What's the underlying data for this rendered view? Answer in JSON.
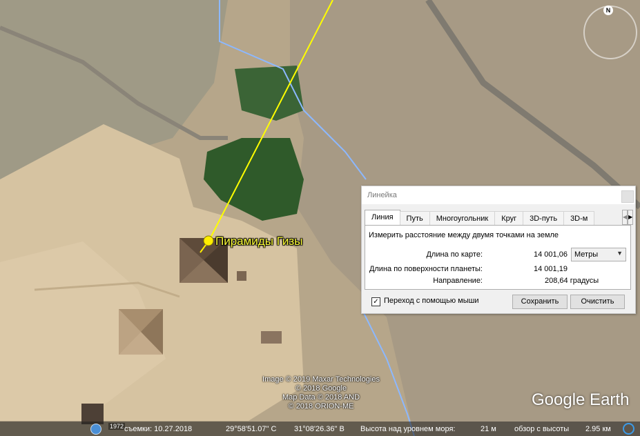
{
  "map": {
    "placemark_label": "Пирамиды Гизы",
    "attribution_lines": [
      "Image © 2019 Maxar Technologies",
      "© 2018 Google",
      "Map Data © 2018 AND",
      "© 2018 ORION-ME"
    ],
    "logo": "Google Earth",
    "compass_letter": "N",
    "colors": {
      "ruler_line": "#ffff00",
      "road_outline": "#8cb8ff",
      "placemark": "#ffee00"
    }
  },
  "ruler": {
    "title": "Линейка",
    "tabs": [
      "Линия",
      "Путь",
      "Многоугольник",
      "Круг",
      "3D-путь",
      "3D-м"
    ],
    "active_tab": "Линия",
    "description": "Измерить расстояние между двумя точками на земле",
    "map_length_label": "Длина по карте:",
    "map_length_value": "14 001,06",
    "units": "Метры",
    "ground_length_label": "Длина по поверхности планеты:",
    "ground_length_value": "14 001,19",
    "heading_label": "Направление:",
    "heading_value": "208,64 градусы",
    "mouse_nav_label": "Переход с помощью мыши",
    "mouse_nav_checked": "✓",
    "save_label": "Сохранить",
    "clear_label": "Очистить"
  },
  "status": {
    "tour_year": "1972",
    "capture_date": "съемки: 10.27.2018",
    "latitude": "29°58'51.07\" С",
    "longitude": "31°08'26.36\" В",
    "elevation_label": "Высота над уровнем моря:",
    "elevation_value": "21 м",
    "eye_alt_label": "обзор с высоты",
    "eye_alt_value": "2.95 км"
  }
}
